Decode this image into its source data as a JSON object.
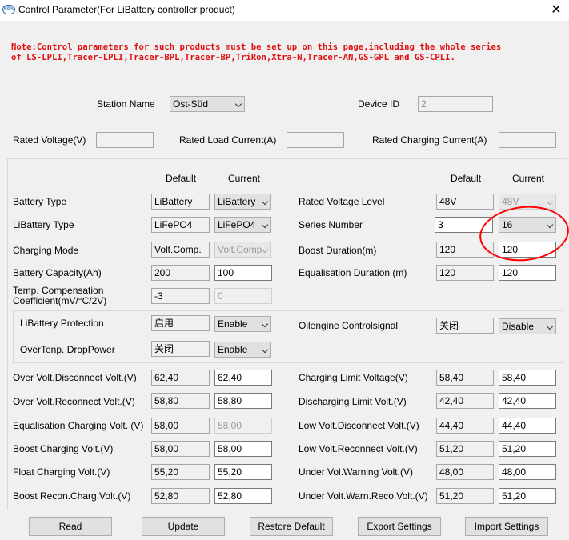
{
  "window": {
    "title": "Control Parameter(For LiBattery controller product)",
    "icon_label": "EPS",
    "close_glyph": "✕"
  },
  "note": {
    "line1": "Note:Control parameters for such products must be set up on this page,including the whole series",
    "line2": "of LS-LPLI,Tracer-LPLI,Tracer-BPL,Tracer-BP,TriRon,Xtra-N,Tracer-AN,GS-GPL and GS-CPLI."
  },
  "station": {
    "label": "Station Name",
    "value": "Ost-Süd"
  },
  "device": {
    "label": "Device ID",
    "value": "2"
  },
  "rated": {
    "voltage_label": "Rated Voltage(V)",
    "voltage_value": "",
    "load_label": "Rated Load Current(A)",
    "load_value": "",
    "charging_label": "Rated Charging Current(A)",
    "charging_value": ""
  },
  "headers": {
    "default": "Default",
    "current": "Current"
  },
  "left_rows": {
    "battery_type": {
      "label": "Battery Type",
      "default": "LiBattery",
      "current": "LiBattery"
    },
    "libattery_type": {
      "label": "LiBattery Type",
      "default": "LiFePO4",
      "current": "LiFePO4"
    },
    "charging_mode": {
      "label": "Charging Mode",
      "default": "Volt.Comp.",
      "current": "Volt.Comp"
    },
    "capacity": {
      "label": "Battery Capacity(Ah)",
      "default": "200",
      "current": "100"
    },
    "temp_comp": {
      "label1": "Temp. Compensation",
      "label2": "Coefficient(mV/°C/2V)",
      "default": "-3",
      "current": "0"
    }
  },
  "right_rows": {
    "rated_level": {
      "label": "Rated Voltage Level",
      "default": "48V",
      "current": "48V"
    },
    "series": {
      "label": "Series Number",
      "default": "3",
      "current": "16"
    },
    "boost_duration": {
      "label": "Boost Duration(m)",
      "default": "120",
      "current": "120"
    },
    "equal_duration": {
      "label": "Equalisation Duration (m)",
      "default": "120",
      "current": "120"
    }
  },
  "protection": {
    "lib_label": "LiBattery Protection",
    "lib_default": "启用",
    "lib_current": "Enable",
    "overtemp_label": "OverTenp. DropPower",
    "overtemp_default": "关闭",
    "overtemp_current": "Enable",
    "oil_label": "Oilengine Controlsignal",
    "oil_default": "关闭",
    "oil_current": "Disable"
  },
  "voltages_left": [
    {
      "label": "Over Volt.Disconnect Volt.(V)",
      "default": "62,40",
      "current": "62,40",
      "disabled": false
    },
    {
      "label": "Over Volt.Reconnect Volt.(V)",
      "default": "58,80",
      "current": "58,80",
      "disabled": false
    },
    {
      "label": "Equalisation Charging Volt. (V)",
      "default": "58,00",
      "current": "58,00",
      "disabled": true
    },
    {
      "label": "Boost Charging Volt.(V)",
      "default": "58,00",
      "current": "58,00",
      "disabled": false
    },
    {
      "label": "Float Charging Volt.(V)",
      "default": "55,20",
      "current": "55,20",
      "disabled": false
    },
    {
      "label": "Boost Recon.Charg.Volt.(V)",
      "default": "52,80",
      "current": "52,80",
      "disabled": false
    }
  ],
  "voltages_right": [
    {
      "label": "Charging Limit Voltage(V)",
      "default": "58,40",
      "current": "58,40"
    },
    {
      "label": "Discharging Limit Volt.(V)",
      "default": "42,40",
      "current": "42,40"
    },
    {
      "label": "Low Volt.Disconnect Volt.(V)",
      "default": "44,40",
      "current": "44,40"
    },
    {
      "label": "Low Volt.Reconnect Volt.(V)",
      "default": "51,20",
      "current": "51,20"
    },
    {
      "label": "Under Vol.Warning Volt.(V)",
      "default": "48,00",
      "current": "48,00"
    },
    {
      "label": "Under Volt.Warn.Reco.Volt.(V)",
      "default": "51,20",
      "current": "51,20"
    }
  ],
  "buttons": {
    "read": "Read",
    "update": "Update",
    "restore": "Restore Default",
    "export": "Export Settings",
    "import": "Import Settings"
  },
  "colors": {
    "note_red": "#e01010",
    "annotation_red": "#ff0000",
    "window_bg": "#f0f0f0"
  }
}
